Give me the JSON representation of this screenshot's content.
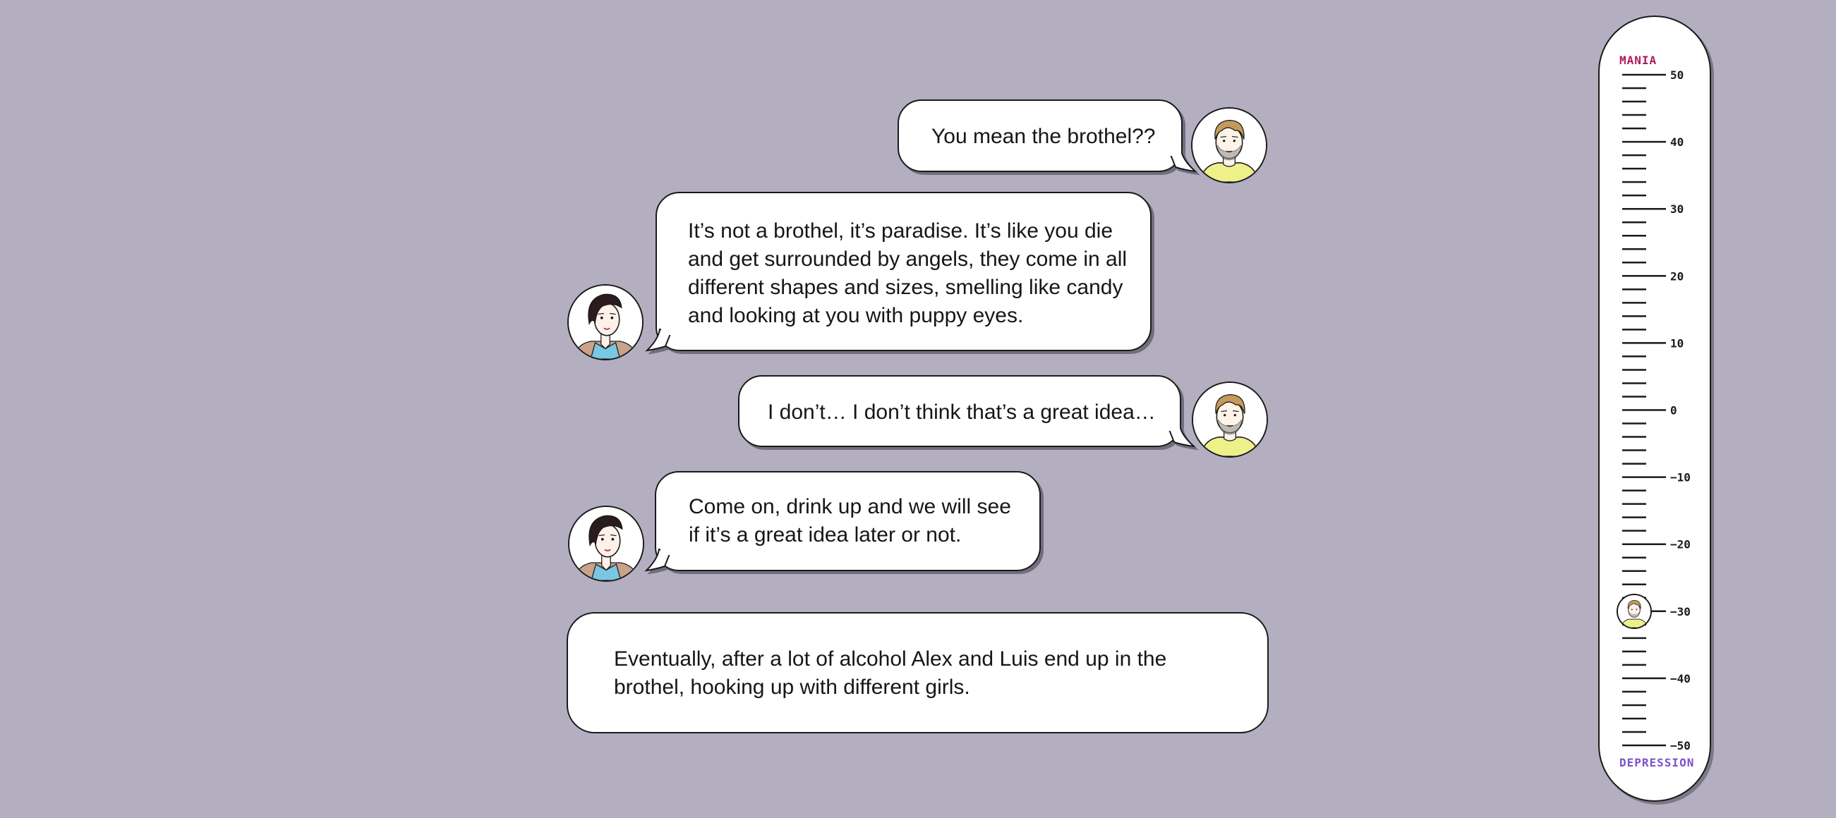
{
  "conversation": [
    {
      "speaker": "man",
      "text": "You mean the brothel??"
    },
    {
      "speaker": "woman",
      "text": "It’s not a brothel, it’s paradise. It’s like you die and get surrounded by angels, they come in all different shapes and sizes, smelling like candy and looking at you with puppy eyes."
    },
    {
      "speaker": "man",
      "text": "I don’t… I don’t think that’s a great idea…"
    },
    {
      "speaker": "woman",
      "text": "Come on, drink up and we will see if it’s a great idea later or not."
    }
  ],
  "narration": {
    "text": "Eventually, after a lot of alcohol Alex and Luis end up in the brothel, hooking up with different girls."
  },
  "meter": {
    "top_label": "MANIA",
    "bottom_label": "DEPRESSION",
    "ticks": [
      "50",
      "40",
      "30",
      "20",
      "10",
      "0",
      "−10",
      "−20",
      "−30",
      "−40",
      "−50"
    ],
    "current_value": -30,
    "marker_icon": "man-avatar-icon",
    "colors": {
      "top_label": "#b0155a",
      "bottom_label": "#7a52c8"
    }
  },
  "colors": {
    "background": "#b3aec0",
    "bubble": "#ffffff",
    "man_shirt": "#eef08a",
    "man_hair": "#c49a5c",
    "woman_hair": "#2a1c1c",
    "woman_jacket": "#79c7e2"
  }
}
